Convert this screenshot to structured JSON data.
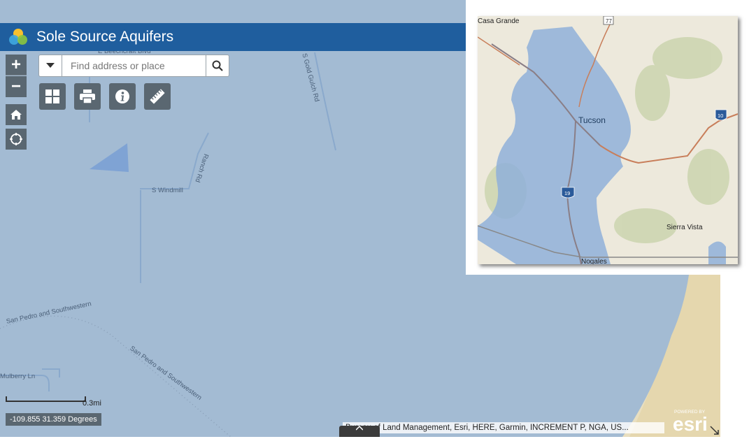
{
  "app": {
    "title": "Sole Source Aquifers"
  },
  "search": {
    "placeholder": "Find address or place"
  },
  "zoom": {
    "in_label": "+",
    "out_label": "−"
  },
  "map_labels": {
    "road1": "E Beechcraft Blvd",
    "road2": "S Gold Gulch Rd",
    "road3": "S Windmill",
    "road4": "Ranch Rd",
    "rail1": "San Pedro and Southwestern",
    "rail2": "San Pedro and Southwestern",
    "road5": "Mulberry Ln"
  },
  "scale": {
    "label": "0.3mi"
  },
  "coordinates": {
    "text": "-109.855 31.359 Degrees"
  },
  "attribution": {
    "text": "Bureau of Land Management, Esri, HERE, Garmin, INCREMENT P, NGA, US..."
  },
  "esri_logo": {
    "powered": "POWERED BY",
    "brand": "esri"
  },
  "overview": {
    "places": {
      "casa_grande": "Casa Grande",
      "tucson": "Tucson",
      "sierra_vista": "Sierra Vista",
      "nogales": "Nogales"
    },
    "shields": {
      "i10": "10",
      "i19": "19",
      "r77": "77"
    }
  },
  "colors": {
    "aquifer": "#9fb8d6",
    "header": "#1f5e9e",
    "control": "#5a6771",
    "terrain": "#e9dfc0"
  }
}
